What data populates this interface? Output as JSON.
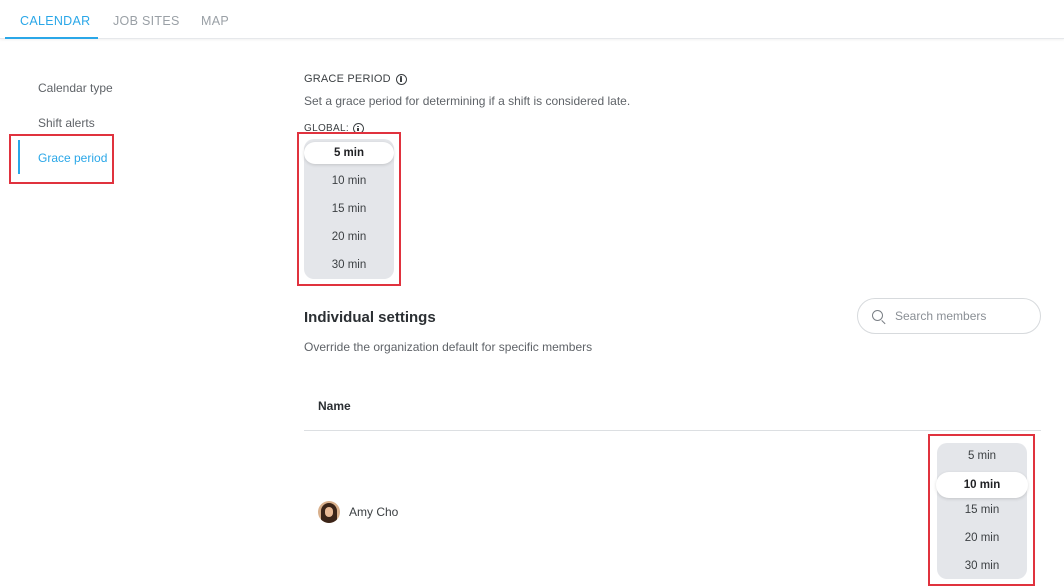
{
  "tabs": [
    {
      "label": "CALENDAR",
      "active": true
    },
    {
      "label": "JOB SITES",
      "active": false
    },
    {
      "label": "MAP",
      "active": false
    }
  ],
  "sidebar": {
    "items": [
      {
        "label": "Calendar type",
        "active": false
      },
      {
        "label": "Shift alerts",
        "active": false
      },
      {
        "label": "Grace period",
        "active": true
      }
    ]
  },
  "grace": {
    "title": "GRACE PERIOD",
    "description": "Set a grace period for determining if a shift is considered late.",
    "global_label": "GLOBAL:",
    "options": [
      "5 min",
      "10 min",
      "15 min",
      "20 min",
      "30 min"
    ],
    "selected": "5 min"
  },
  "individual": {
    "title": "Individual settings",
    "description": "Override the organization default for specific members",
    "search_placeholder": "Search members",
    "column_name": "Name",
    "members": [
      {
        "name": "Amy Cho",
        "options": [
          "5 min",
          "10 min",
          "15 min",
          "20 min",
          "30 min"
        ],
        "selected": "10 min"
      }
    ]
  },
  "colors": {
    "accent": "#2aa7e8",
    "highlight_box": "#e0323e",
    "picker_bg": "#e4e6ea"
  }
}
